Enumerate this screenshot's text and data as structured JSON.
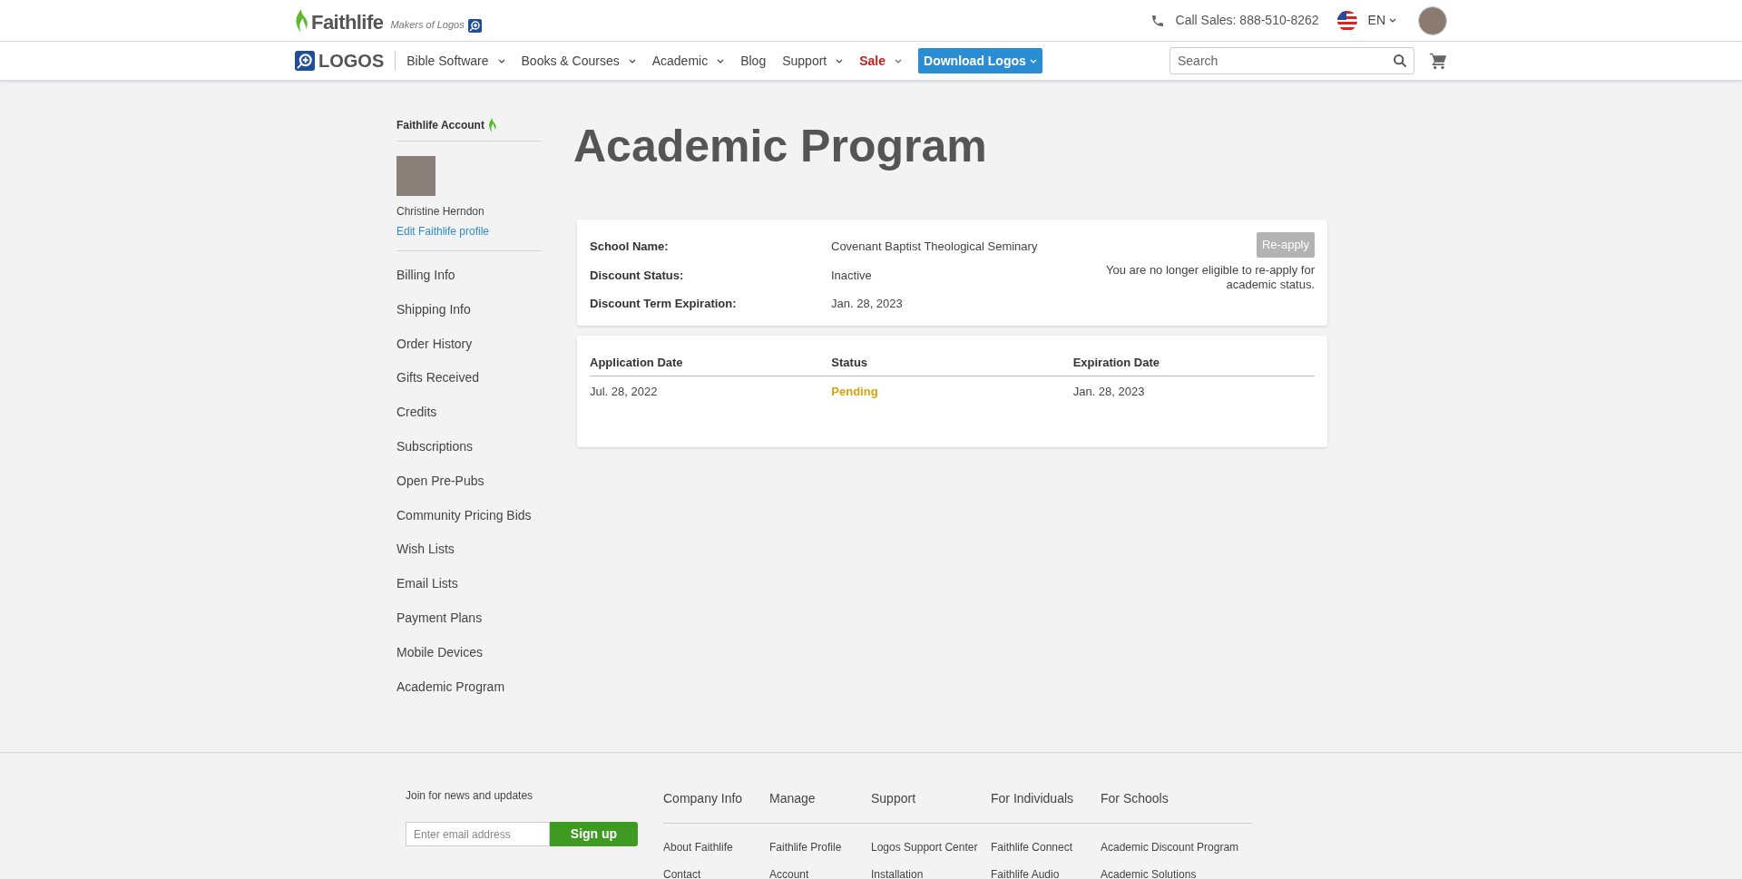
{
  "top_bar": {
    "brand": "Faithlife",
    "tagline": "Makers of Logos",
    "phone": "Call Sales: 888-510-8262",
    "language": "EN"
  },
  "nav": {
    "logo": "LOGOS",
    "items": [
      {
        "label": "Bible Software",
        "kind": "menu"
      },
      {
        "label": "Books & Courses",
        "kind": "menu"
      },
      {
        "label": "Academic",
        "kind": "menu"
      },
      {
        "label": "Blog",
        "kind": "link"
      },
      {
        "label": "Support",
        "kind": "menu"
      },
      {
        "label": "Sale",
        "kind": "sale"
      },
      {
        "label": "Download Logos",
        "kind": "button"
      }
    ],
    "search": {
      "placeholder": "Search"
    }
  },
  "sidebar": {
    "title": "Faithlife Account",
    "user_name": "Christine Herndon",
    "edit_link": "Edit Faithlife profile",
    "items": [
      "Billing Info",
      "Shipping Info",
      "Order History",
      "Gifts Received",
      "Credits",
      "Subscriptions",
      "Open Pre-Pubs",
      "Community Pricing Bids",
      "Wish Lists",
      "Email Lists",
      "Payment Plans",
      "Mobile Devices",
      "Academic Program"
    ]
  },
  "page_title": "Academic Program",
  "details": {
    "fields": [
      {
        "label": "School Name:",
        "value": "Covenant Baptist Theological Seminary"
      },
      {
        "label": "Discount Status:",
        "value": "Inactive"
      },
      {
        "label": "Discount Term Expiration:",
        "value": "Jan. 28, 2023"
      }
    ],
    "reapply_button": {
      "label": "Re-apply",
      "disabled": true
    },
    "note": "You are no longer eligible to re-apply for academic status."
  },
  "applications": {
    "columns": [
      "Application Date",
      "Status",
      "Expiration Date"
    ],
    "rows": [
      {
        "application_date": "Jul. 28, 2022",
        "status": "Pending",
        "color": "#d9a40b",
        "expiration_date": "Jan. 28, 2023"
      }
    ]
  },
  "footer": {
    "newsletter": {
      "label": "Join for news and updates",
      "placeholder": "Enter email address",
      "button": "Sign up"
    },
    "columns": [
      {
        "heading": "Company Info",
        "links": [
          "About Faithlife",
          "Contact"
        ]
      },
      {
        "heading": "Manage",
        "links": [
          "Faithlife Profile",
          "Account"
        ]
      },
      {
        "heading": "Support",
        "links": [
          "Logos Support Center",
          "Installation"
        ]
      },
      {
        "heading": "For Individuals",
        "links": [
          "Faithlife Connect",
          "Faithlife Audio"
        ]
      },
      {
        "heading": "For Schools",
        "links": [
          "Academic Discount Program",
          "Academic Solutions"
        ]
      }
    ]
  }
}
